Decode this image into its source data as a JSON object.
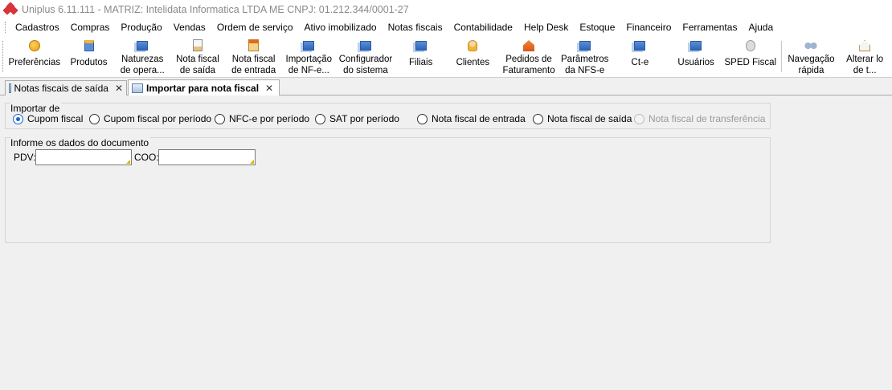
{
  "window": {
    "title": "Uniplus 6.11.111 - MATRIZ: Intelidata Informatica LTDA ME CNPJ: 01.212.344/0001-27"
  },
  "menu": {
    "items": [
      "Cadastros",
      "Compras",
      "Produção",
      "Vendas",
      "Ordem de serviço",
      "Ativo imobilizado",
      "Notas fiscais",
      "Contabilidade",
      "Help Desk",
      "Estoque",
      "Financeiro",
      "Ferramentas",
      "Ajuda"
    ]
  },
  "toolbar": {
    "buttons": [
      {
        "label": "Preferências",
        "icon": "preferences-icon"
      },
      {
        "label": "Produtos",
        "icon": "products-icon"
      },
      {
        "label": "Naturezas\nde opera...",
        "icon": "nature-operation-icon"
      },
      {
        "label": "Nota fiscal\nde saída",
        "icon": "invoice-out-icon"
      },
      {
        "label": "Nota fiscal\nde entrada",
        "icon": "invoice-in-icon"
      },
      {
        "label": "Importação\nde NF-e...",
        "icon": "import-nfe-icon"
      },
      {
        "label": "Configurador\ndo sistema",
        "icon": "system-config-icon"
      },
      {
        "label": "Filiais",
        "icon": "branches-icon"
      },
      {
        "label": "Clientes",
        "icon": "clients-icon"
      },
      {
        "label": "Pedidos de\nFaturamento",
        "icon": "billing-orders-icon"
      },
      {
        "label": "Parâmetros\nda NFS-e",
        "icon": "nfse-params-icon"
      },
      {
        "label": "Ct-e",
        "icon": "cte-icon"
      },
      {
        "label": "Usuários",
        "icon": "users-icon"
      },
      {
        "label": "SPED Fiscal",
        "icon": "sped-icon"
      },
      {
        "label": "Navegação\nrápida",
        "icon": "binoculars-icon"
      },
      {
        "label": "Alterar lo\nde t...",
        "icon": "home-icon"
      }
    ]
  },
  "tabs": [
    {
      "label": "Notas fiscais de saída",
      "close": "✕",
      "active": false
    },
    {
      "label": "Importar para nota fiscal",
      "close": "✕",
      "active": true
    }
  ],
  "import_group": {
    "title": "Importar de",
    "options": [
      {
        "label": "Cupom fiscal",
        "checked": true,
        "enabled": true
      },
      {
        "label": "Cupom fiscal por período",
        "checked": false,
        "enabled": true
      },
      {
        "label": "NFC-e por período",
        "checked": false,
        "enabled": true
      },
      {
        "label": "SAT por período",
        "checked": false,
        "enabled": true
      },
      {
        "label": "Nota fiscal de entrada",
        "checked": false,
        "enabled": true
      },
      {
        "label": "Nota fiscal de saída",
        "checked": false,
        "enabled": true
      },
      {
        "label": "Nota fiscal de transferência",
        "checked": false,
        "enabled": false
      }
    ]
  },
  "document_group": {
    "title": "Informe os dados do documento",
    "pdv_label": "PDV:",
    "pdv_value": "",
    "coo_label": "COO:",
    "coo_value": ""
  }
}
